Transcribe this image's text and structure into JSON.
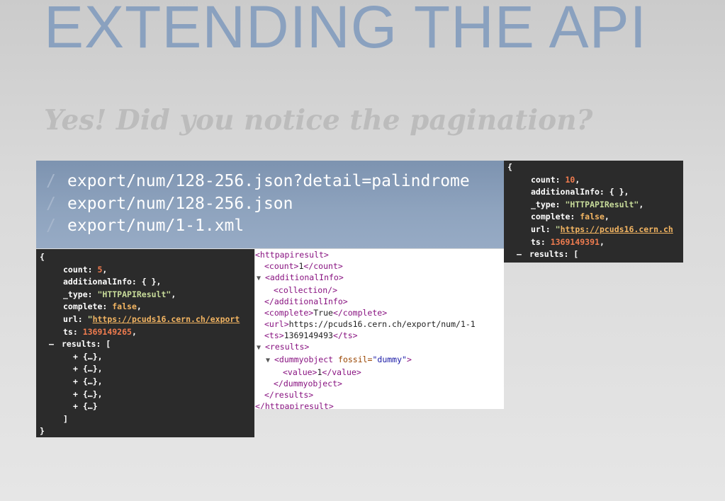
{
  "slide": {
    "title": "EXTENDING THE API",
    "subtitle": "Yes! Did you notice the pagination?"
  },
  "urls": [
    {
      "slash": "/",
      "path": "export/num/128-256.json?detail=palindrome"
    },
    {
      "slash": "/",
      "path": "export/num/128-256.json"
    },
    {
      "slash": "/",
      "path": "export/num/1-1.xml"
    }
  ],
  "json_main": {
    "open_brace": "{",
    "count_key": "count: ",
    "count_val": "5",
    "additional_line": "additionalInfo: { },",
    "type_key": "_type: ",
    "type_val": "\"HTTPAPIResult\"",
    "complete_key": "complete: ",
    "complete_val": "false",
    "url_key": "url: ",
    "url_quote": "\"",
    "url_val": "https://pcuds16.cern.ch/export",
    "ts_key": "ts: ",
    "ts_val": "1369149265",
    "results_toggle": "–",
    "results_label": "results: [",
    "items": [
      "+ {…},",
      "+ {…},",
      "+ {…},",
      "+ {…},",
      "+ {…}"
    ],
    "close_bracket": "]",
    "close_brace": "}"
  },
  "json_top": {
    "open_brace": "{",
    "count_key": "count: ",
    "count_val": "10",
    "additional_line": "additionalInfo: { },",
    "type_key": "_type: ",
    "type_val": "\"HTTPAPIResult\"",
    "complete_key": "complete: ",
    "complete_val": "false",
    "url_key": "url: ",
    "url_quote": "\"",
    "url_val": "https://pcuds16.cern.ch",
    "ts_key": "ts: ",
    "ts_val": "1369149391",
    "results_toggle": "–",
    "results_label": "results: ["
  },
  "xml": {
    "root_open": "<httpapiresult>",
    "count_open": "<count>",
    "count_val": "1",
    "count_close": "</count>",
    "additional_open": "<additionalInfo>",
    "collection": "<collection/>",
    "additional_close": "</additionalInfo>",
    "complete_open": "<complete>",
    "complete_val": "True",
    "complete_close": "</complete>",
    "url_open": "<url>",
    "url_val": "https://pcuds16.cern.ch/export/num/1-1",
    "ts_open": "<ts>",
    "ts_val": "1369149493",
    "ts_close": "</ts>",
    "results_open": "<results>",
    "dummy_open": "<dummyobject ",
    "dummy_attr": "fossil=",
    "dummy_attr_val": "\"dummy\"",
    "dummy_end": ">",
    "value_open": "<value>",
    "value_val": "1",
    "value_close": "</value>",
    "dummy_close": "</dummyobject>",
    "results_close": "</results>",
    "root_close": "</httpapiresult>",
    "arrow": "▼"
  }
}
